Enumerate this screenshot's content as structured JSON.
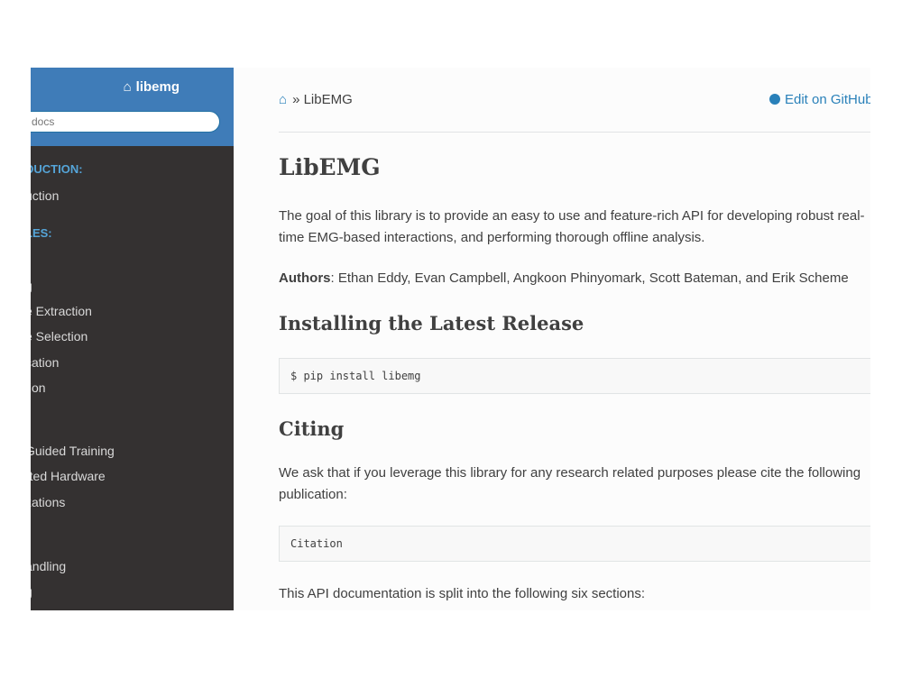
{
  "sidebar": {
    "brand": "libemg",
    "search_placeholder": "docs",
    "items": [
      {
        "type": "caption",
        "label": "DUCTION:"
      },
      {
        "type": "link",
        "label": "uction"
      },
      {
        "type": "caption",
        "label": "LES:"
      },
      {
        "type": "link",
        "label": "g"
      },
      {
        "type": "link",
        "label": "e Extraction"
      },
      {
        "type": "link",
        "label": "e Selection"
      },
      {
        "type": "link",
        "label": "cation"
      },
      {
        "type": "link",
        "label": "tion"
      },
      {
        "type": "caption",
        "label": ":"
      },
      {
        "type": "link",
        "label": " Guided Training"
      },
      {
        "type": "link",
        "label": "rted Hardware"
      },
      {
        "type": "link",
        "label": "zations"
      },
      {
        "type": "link",
        "label": "andling"
      },
      {
        "type": "link",
        "label": "g"
      }
    ]
  },
  "breadcrumb": {
    "separator": "»",
    "current": "LibEMG"
  },
  "edit_link": "Edit on GitHub",
  "content": {
    "title": "LibEMG",
    "intro": "The goal of this library is to provide an easy to use and feature-rich API for developing robust real-time EMG-based interactions, and performing thorough offline analysis.",
    "authors_label": "Authors",
    "authors": ": Ethan Eddy, Evan Campbell, Angkoon Phinyomark, Scott Bateman, and Erik Scheme",
    "install_heading": "Installing the Latest Release",
    "install_code": "$ pip install libemg",
    "citing_heading": "Citing",
    "citing_text": "We ask that if you leverage this library for any research related purposes please cite the following publication:",
    "citation_code": "Citation",
    "sections_text": "This API documentation is split into the following six sections:"
  },
  "colors": {
    "sidebar_top": "#3f7cb8",
    "sidebar_bg": "#343131",
    "caption": "#55a5d9",
    "link": "#2980b9"
  }
}
